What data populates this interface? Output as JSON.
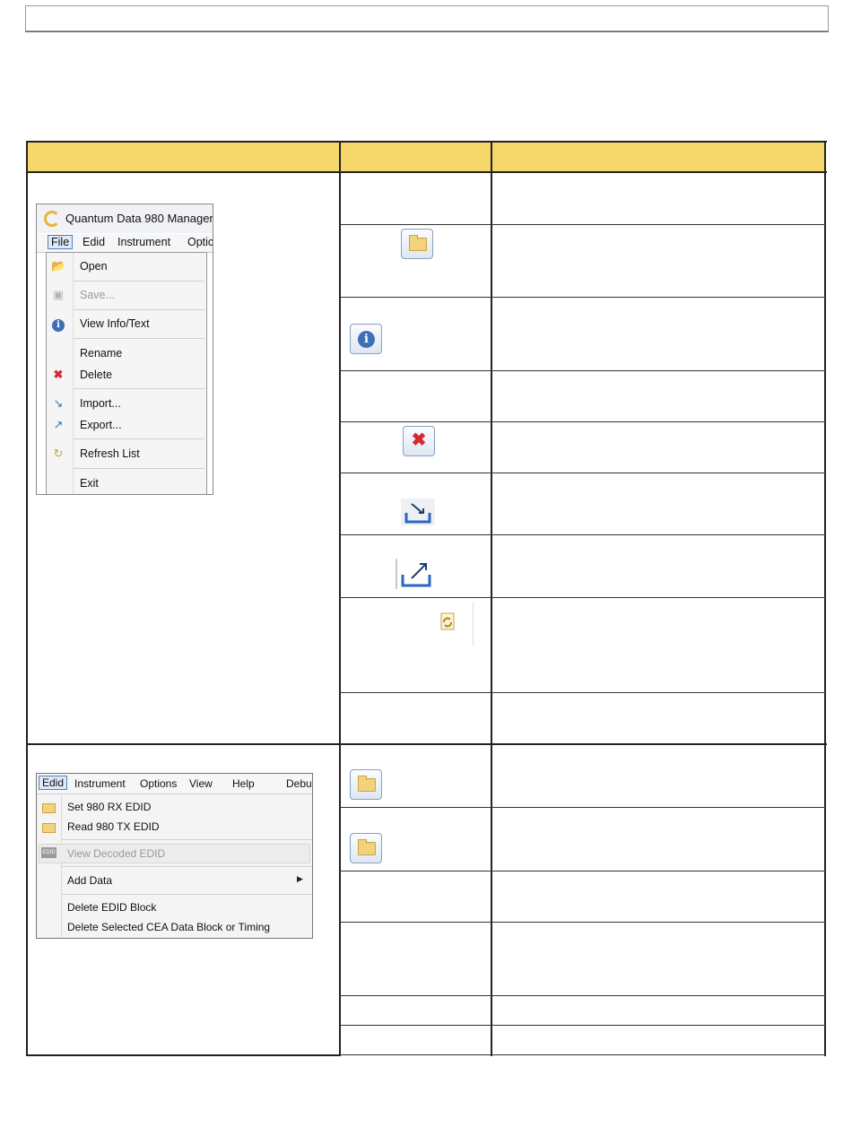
{
  "file_menu_screenshot": {
    "title": "Quantum Data 980 Manager",
    "menubar": [
      "File",
      "Edid",
      "Instrument",
      "Optic"
    ],
    "items": [
      {
        "label": "Open",
        "icon": "open-folder-icon",
        "disabled": false
      },
      {
        "label": "Save...",
        "icon": "save-icon",
        "disabled": true
      },
      {
        "label": "View Info/Text",
        "icon": "info-icon",
        "disabled": false
      },
      {
        "label": "Rename",
        "icon": "",
        "disabled": false
      },
      {
        "label": "Delete",
        "icon": "delete-x-icon",
        "disabled": false
      },
      {
        "label": "Import...",
        "icon": "import-icon",
        "disabled": false
      },
      {
        "label": "Export...",
        "icon": "export-icon",
        "disabled": false
      },
      {
        "label": "Refresh List",
        "icon": "refresh-icon",
        "disabled": false
      },
      {
        "label": "Exit",
        "icon": "",
        "disabled": false
      }
    ]
  },
  "edid_menu_screenshot": {
    "menubar": [
      "Edid",
      "Instrument",
      "Options",
      "View",
      "Help",
      "Debu"
    ],
    "items": [
      {
        "label": "Set 980 RX EDID",
        "icon": "folder-icon",
        "disabled": false
      },
      {
        "label": "Read 980 TX EDID",
        "icon": "folder-icon",
        "disabled": false
      },
      {
        "label": "View Decoded EDID",
        "icon": "edid-icon",
        "disabled": true
      },
      {
        "label": "Add Data",
        "icon": "",
        "disabled": false,
        "submenu": true
      },
      {
        "label": "Delete EDID Block",
        "icon": "",
        "disabled": false
      },
      {
        "label": "Delete Selected CEA Data Block or Timing",
        "icon": "",
        "disabled": false
      }
    ]
  },
  "colors": {
    "header_fill": "#f5d76b",
    "rule": "#222222"
  }
}
